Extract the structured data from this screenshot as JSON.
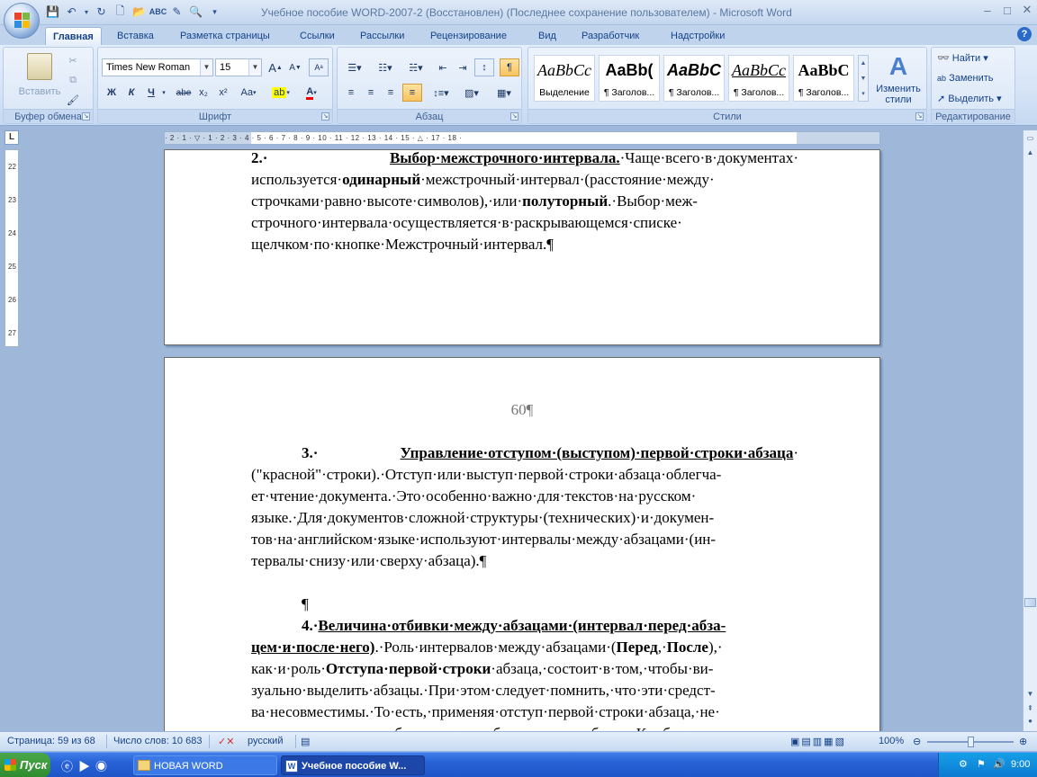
{
  "window": {
    "title": "Учебное пособие WORD-2007-2 (Восстановлен) (Последнее сохранение пользователем) - Microsoft Word",
    "controls": [
      "minimize-icon",
      "maximize-icon",
      "close-icon"
    ]
  },
  "quick_access": [
    "save-icon",
    "undo-icon",
    "redo-icon",
    "new-icon",
    "open-icon",
    "spelling-icon",
    "edit-icon",
    "print-preview-icon",
    "customize-icon"
  ],
  "tabs": [
    "Главная",
    "Вставка",
    "Разметка страницы",
    "Ссылки",
    "Рассылки",
    "Рецензирование",
    "Вид",
    "Разработчик",
    "Надстройки"
  ],
  "active_tab": "Главная",
  "ribbon": {
    "clipboard": {
      "label": "Буфер обмена",
      "paste": "Вставить"
    },
    "font": {
      "label": "Шрифт",
      "name": "Times New Roman",
      "size": "15",
      "bold": "Ж",
      "italic": "К",
      "underline": "Ч",
      "strike": "abe",
      "sub": "x₂",
      "sup": "x²",
      "change_case": "Aa",
      "grow": "A",
      "shrink": "A"
    },
    "paragraph": {
      "label": "Абзац"
    },
    "styles": {
      "label": "Стили",
      "tiles": [
        {
          "sample": "AaBbCc",
          "name": "Выделение"
        },
        {
          "sample": "AaBb(",
          "name": "¶ Заголов..."
        },
        {
          "sample": "AaBbC",
          "name": "¶ Заголов..."
        },
        {
          "sample": "AaBbCc",
          "name": "¶ Заголов..."
        },
        {
          "sample": "AaBbC",
          "name": "¶ Заголов..."
        }
      ],
      "change_styles": "Изменить стили"
    },
    "editing": {
      "label": "Редактирование",
      "find": "Найти",
      "replace": "Заменить",
      "select": "Выделить"
    }
  },
  "ruler": {
    "corner": "L",
    "ticks": "· 2 · 1 · ▽ · 1 · 2 · 3 · 4 · 5 · 6 · 7 · 8 · 9 · 10 · 11 · 12 · 13 · 14 · 15 · △ · 17 · 18 ·",
    "vticks": [
      "22",
      "23",
      "24",
      "25",
      "26",
      "27"
    ]
  },
  "page1": {
    "lines": [
      {
        "parts": [
          {
            "t": "2.· ",
            "b": true
          },
          {
            "t": "Выбор·межстрочного·интервала.",
            "b": true,
            "u": true
          },
          {
            "t": "·Чаще·всего·в·документах·"
          }
        ]
      },
      {
        "parts": [
          {
            "t": "используется·"
          },
          {
            "t": "одинарный",
            "b": true
          },
          {
            "t": "·межстрочный·интервал·(расстояние·между·"
          }
        ]
      },
      {
        "parts": [
          {
            "t": "строчками·равно·высоте·символов),·или·"
          },
          {
            "t": "полуторный",
            "b": true
          },
          {
            "t": ".·Выбор·меж-"
          }
        ]
      },
      {
        "parts": [
          {
            "t": "строчного·интервала·осуществляется·в·раскрывающемся·списке·"
          }
        ]
      },
      {
        "parts": [
          {
            "t": "щелчком·по·кнопке·Межстрочный·интервал.¶"
          }
        ],
        "last": true
      }
    ]
  },
  "page2": {
    "page_number": "60¶",
    "lines": [
      {
        "parts": [
          {
            "t": "3.· ",
            "b": true
          },
          {
            "t": "Управление·отступом·(выступом)·первой·строки·абзаца",
            "b": true,
            "u": true
          },
          {
            "t": "·"
          }
        ],
        "indent": true
      },
      {
        "parts": [
          {
            "t": "(\"красной\"·строки).·Отступ·или·выступ·первой·строки·абзаца·облегча-"
          }
        ]
      },
      {
        "parts": [
          {
            "t": "ет·чтение·документа.·Это·особенно·важно·для·текстов·на·русском·"
          }
        ]
      },
      {
        "parts": [
          {
            "t": "языке.·Для·документов·сложной·структуры·(технических)·и·докумен-"
          }
        ]
      },
      {
        "parts": [
          {
            "t": "тов·на·английском·языке·используют·интервалы·между·абзацами·(ин-"
          }
        ]
      },
      {
        "parts": [
          {
            "t": "тервалы·снизу·или·сверху·абзаца).¶"
          }
        ],
        "last": true
      },
      {
        "parts": [
          {
            "t": ""
          }
        ],
        "last": true
      },
      {
        "parts": [
          {
            "t": "¶"
          }
        ],
        "last": true,
        "indent": true
      },
      {
        "parts": [
          {
            "t": "4.·",
            "b": true
          },
          {
            "t": "Величина·отбивки·между·абзацами·(интервал·перед·абза-",
            "b": true,
            "u": true
          }
        ],
        "indent": true
      },
      {
        "parts": [
          {
            "t": "цем·и·после·него)",
            "b": true,
            "u": true
          },
          {
            "t": ".·Роль·интервалов·между·абзацами·("
          },
          {
            "t": "Перед",
            "b": true
          },
          {
            "t": ",·"
          },
          {
            "t": "После",
            "b": true
          },
          {
            "t": "),·"
          }
        ]
      },
      {
        "parts": [
          {
            "t": "как·и·роль·"
          },
          {
            "t": "Отступа·первой·строки",
            "b": true
          },
          {
            "t": "·абзаца,·состоит·в·том,·чтобы·ви-"
          }
        ]
      },
      {
        "parts": [
          {
            "t": "зуально·выделить·абзацы.·При·этом·следует·помнить,·что·эти·средст-"
          }
        ]
      },
      {
        "parts": [
          {
            "t": "ва·несовместимы.·То·есть,·применяя·отступ·первой·строки·абзаца,·не·"
          }
        ]
      },
      {
        "parts": [
          {
            "t": "следует·применять·отбивки·между·абзацами,·и·наоборот.·Комбинация·"
          }
        ]
      }
    ]
  },
  "statusbar": {
    "page": "Страница: 59 из 68",
    "words": "Число слов: 10 683",
    "language": "русский",
    "zoom": "100%"
  },
  "taskbar": {
    "start": "Пуск",
    "items": [
      "НОВАЯ WORD",
      "Учебное пособие W..."
    ],
    "lang": "RU",
    "clock": "9:00"
  },
  "colors": {
    "accent": "#15428b",
    "ribbon": "#d5e3f6",
    "workspace": "#9fb8d9",
    "taskbar": "#2762d6"
  }
}
